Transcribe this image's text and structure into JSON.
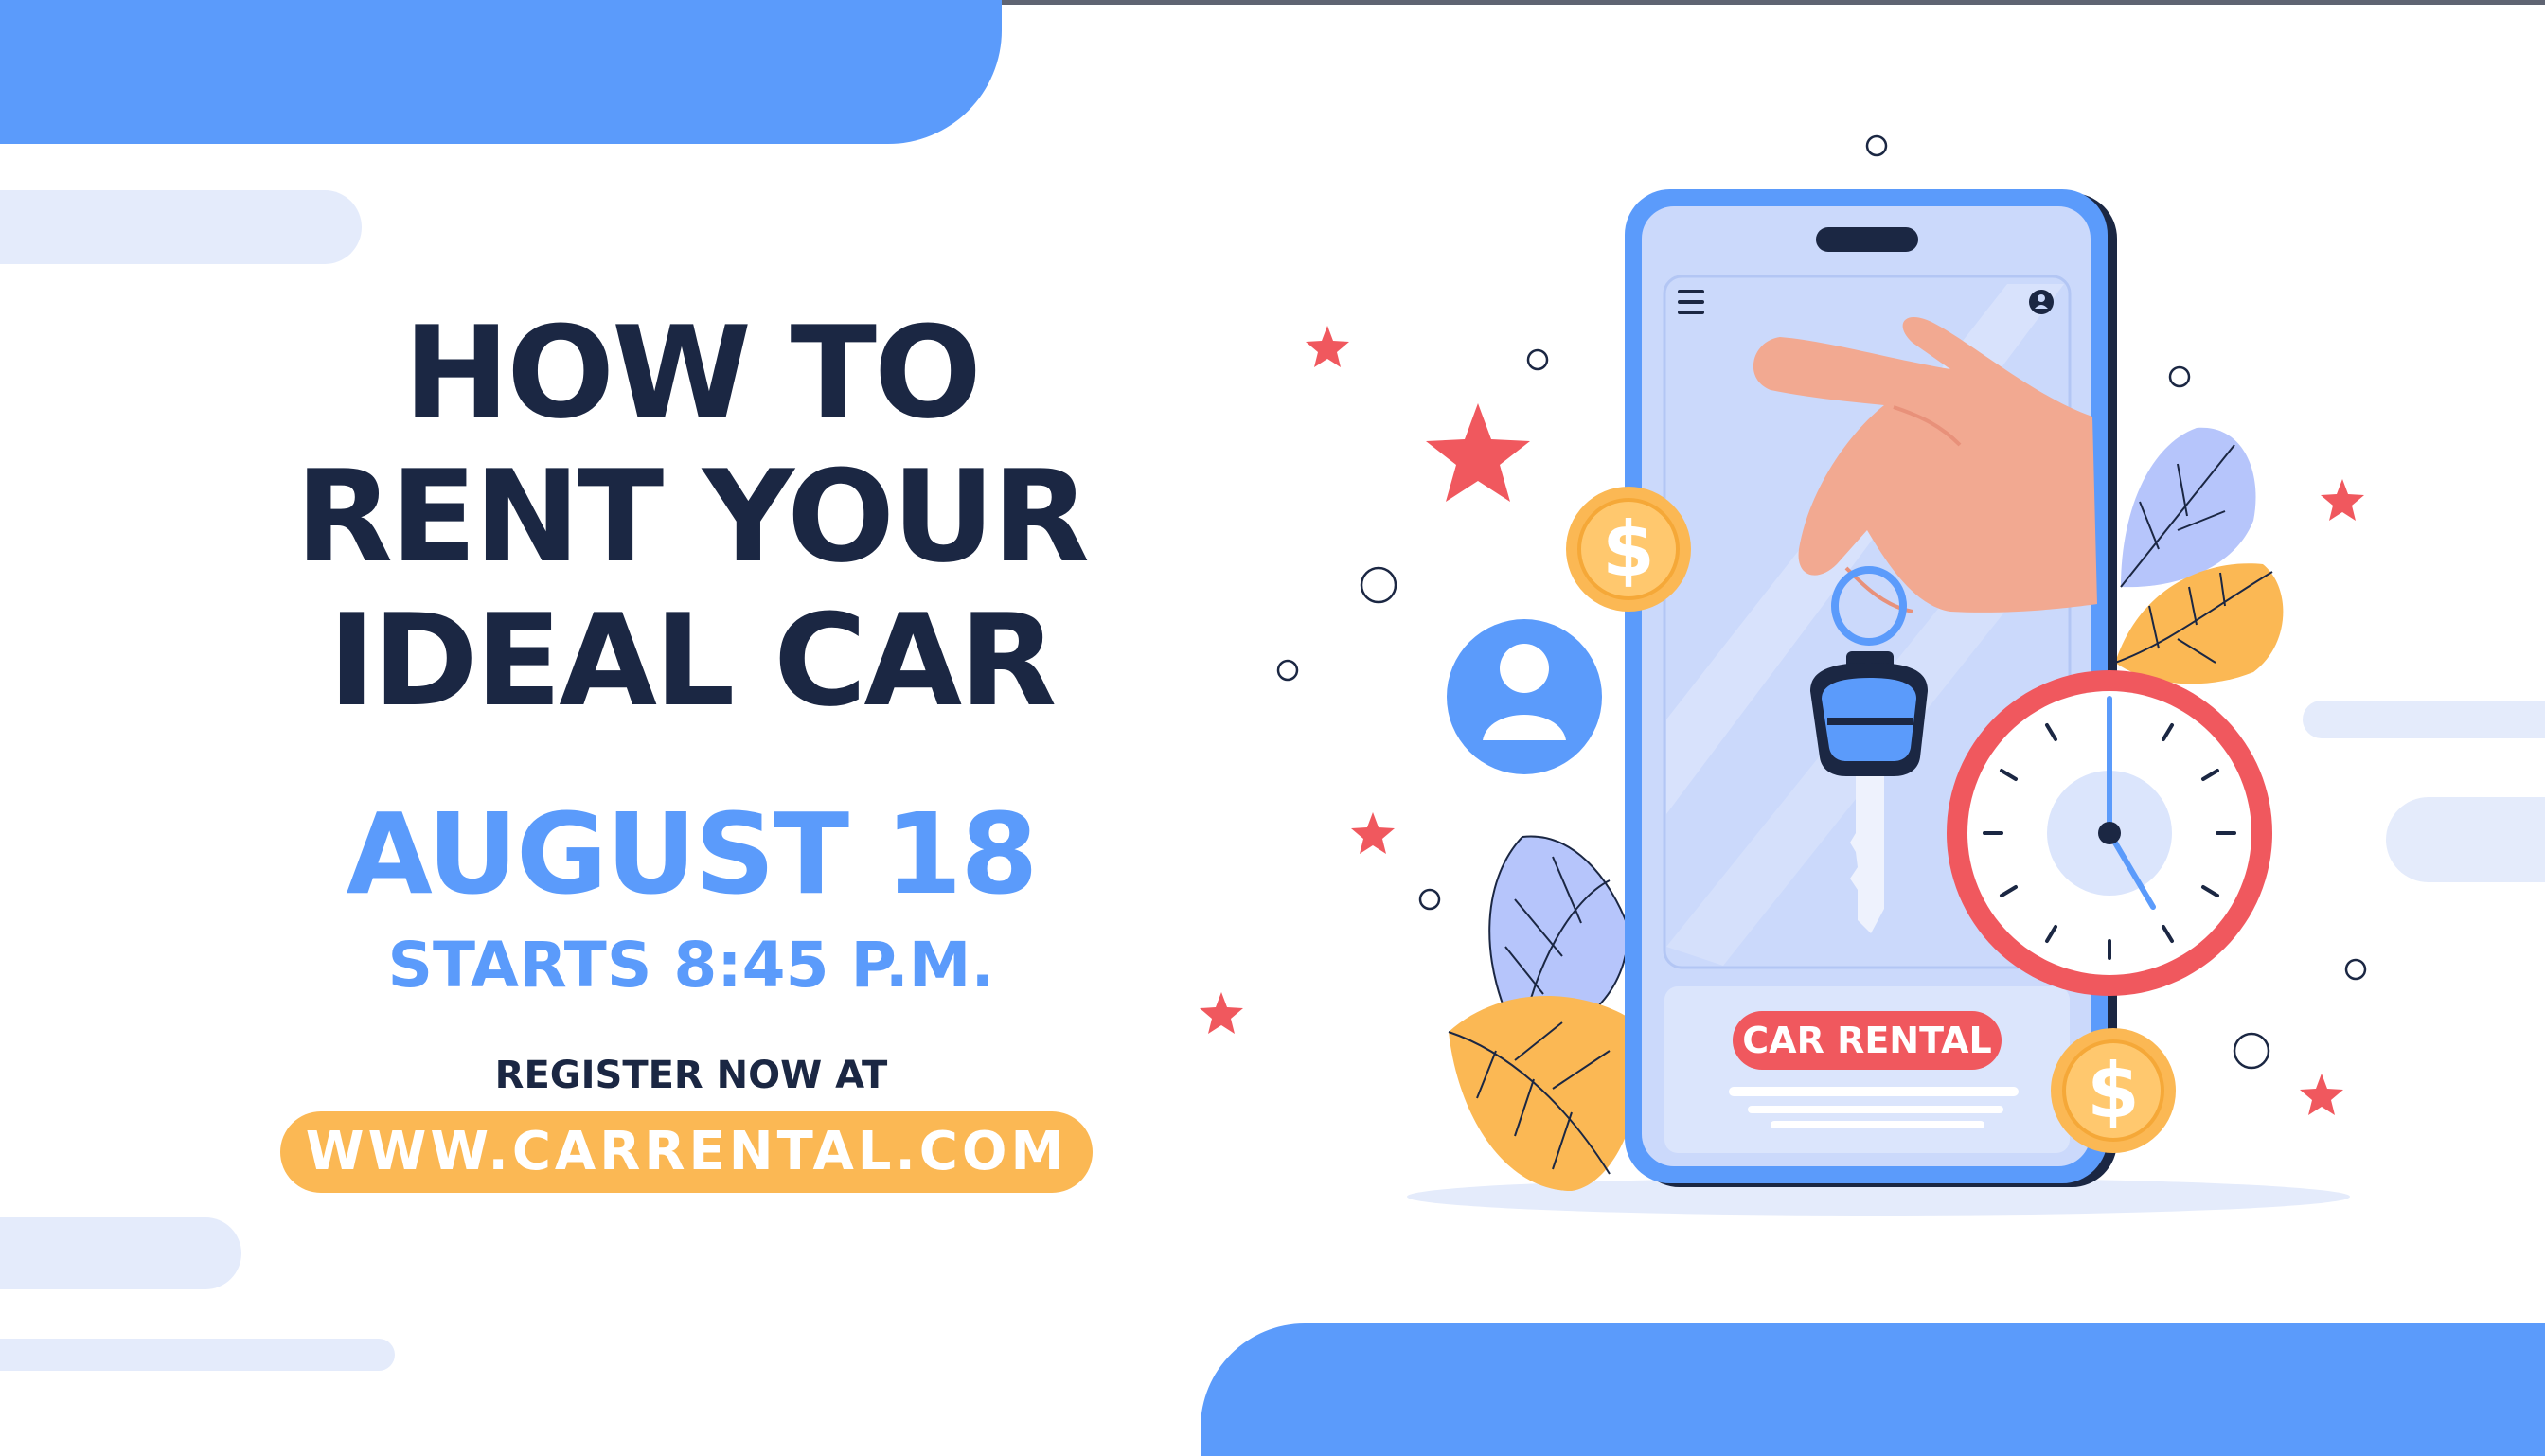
{
  "headline": {
    "line1": "HOW TO",
    "line2": "RENT YOUR",
    "line3": "IDEAL CAR"
  },
  "event": {
    "date": "AUGUST 18",
    "time": "STARTS 8:45 P.M."
  },
  "registration": {
    "label": "REGISTER NOW AT",
    "url": "WWW.CARRENTAL.COM"
  },
  "illustration": {
    "app_badge": "CAR RENTAL",
    "coin_symbol": "$",
    "icons": [
      "menu-icon",
      "profile-icon",
      "hand-icon",
      "car-key-icon",
      "clock-icon",
      "dollar-coin-icon",
      "user-avatar-icon",
      "star-icon",
      "leaf-icon"
    ]
  },
  "colors": {
    "primary_blue": "#5b9bfb",
    "navy": "#1b2743",
    "accent_yellow": "#fbb854",
    "accent_red": "#f0585e",
    "light_pill": "#e4ebfb"
  }
}
